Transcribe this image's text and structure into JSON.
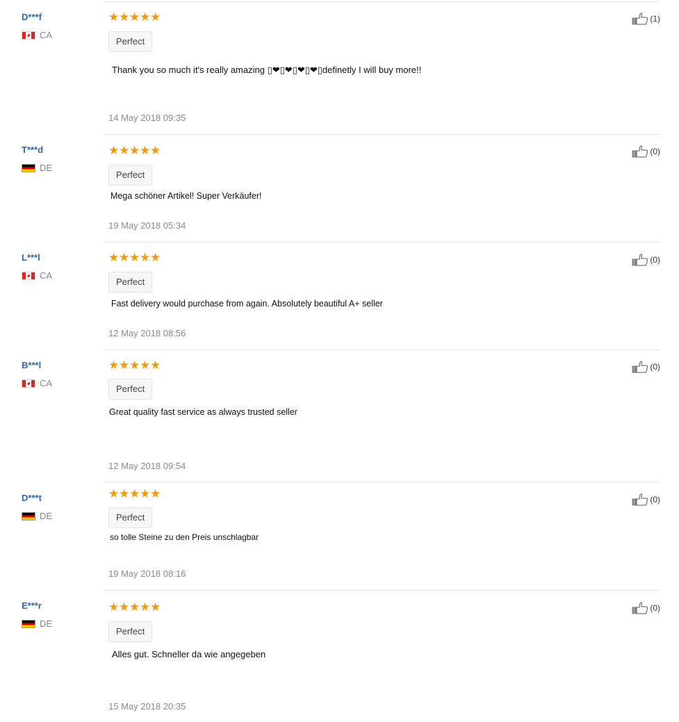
{
  "reviews": [
    {
      "user": "D***f",
      "country": "CA",
      "stars": "★★★★★",
      "tag": "Perfect",
      "comment": "Thank you so much it's really amazing ▯❤▯❤▯❤▯❤▯definetly I will buy more!!",
      "date": "14 May 2018 09:35",
      "helpful": "(1)"
    },
    {
      "user": "T***d",
      "country": "DE",
      "stars": "★★★★★",
      "tag": "Perfect",
      "comment": "Mega schöner Artikel! Super Verkäufer!",
      "date": "19 May 2018 05:34",
      "helpful": "(0)"
    },
    {
      "user": "L***l",
      "country": "CA",
      "stars": "★★★★★",
      "tag": "Perfect",
      "comment": "Fast delivery would purchase from again. Absolutely beautiful A+ seller",
      "date": "12 May 2018 08:56",
      "helpful": "(0)"
    },
    {
      "user": "B***l",
      "country": "CA",
      "stars": "★★★★★",
      "tag": "Perfect",
      "comment": "Great quality fast service as always trusted seller",
      "date": "12 May 2018 09:54",
      "helpful": "(0)"
    },
    {
      "user": "D***t",
      "country": "DE",
      "stars": "★★★★★",
      "tag": "Perfect",
      "comment": "so tolle Steine zu den Preis unschlagbar",
      "date": "19 May 2018 08:16",
      "helpful": "(0)"
    },
    {
      "user": "E***r",
      "country": "DE",
      "stars": "★★★★★",
      "tag": "Perfect",
      "comment": "Alles gut. Schneller da wie angegeben",
      "date": "15 May 2018 20:35",
      "helpful": "(0)"
    }
  ],
  "colors": {
    "username": "#2b6aa3",
    "star": "#f29a0c",
    "date": "#8a8a8a"
  },
  "icons": {
    "helpful": "thumbs-up-icon",
    "rating": "star-icon"
  }
}
